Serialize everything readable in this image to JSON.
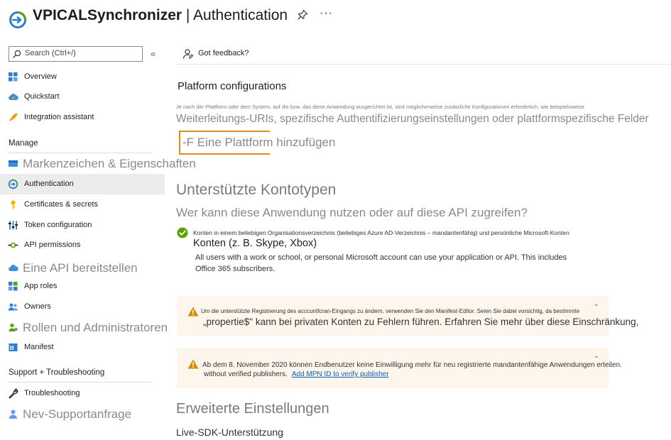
{
  "header": {
    "app_name": "VPICALSynchronizer",
    "separator": " | ",
    "page_name": "Authentication",
    "more_label": "···"
  },
  "sidebar": {
    "search_placeholder": "Search (Ctrl+/)",
    "collapse_label": "«",
    "items_top": [
      {
        "label": "Overview",
        "icon": "grid-icon"
      },
      {
        "label": "Quickstart",
        "icon": "cloud-icon"
      },
      {
        "label": "Integration assistant",
        "icon": "rocket-icon"
      }
    ],
    "section_manage": "Manage",
    "items_manage": [
      {
        "label": "Markenzeichen & Eigenschaften",
        "icon": "branding-icon"
      },
      {
        "label": "Authentication",
        "icon": "authentication-icon",
        "active": true
      },
      {
        "label": "Certificates & secrets",
        "icon": "key-icon"
      },
      {
        "label": "Token configuration",
        "icon": "token-icon"
      },
      {
        "label": "API permissions",
        "icon": "api-permissions-icon"
      },
      {
        "label": "Eine API bereitstellen",
        "icon": "cloud-api-icon"
      },
      {
        "label": "App roles",
        "icon": "app-roles-icon"
      },
      {
        "label": "Owners",
        "icon": "owners-icon"
      },
      {
        "label": "Rollen und Administratoren",
        "icon": "roles-icon"
      },
      {
        "label": "Manifest",
        "icon": "manifest-icon"
      }
    ],
    "section_support": "Support + Troubleshooting",
    "items_support": [
      {
        "label": "Troubleshooting",
        "icon": "wrench-icon"
      },
      {
        "label": "Nev-Supportanfrage",
        "icon": "support-person-icon"
      }
    ]
  },
  "cmdbar": {
    "feedback_label": "Got feedback?"
  },
  "platform": {
    "heading": "Platform configurations",
    "desc_small": "Je nach der Plattform oder dem System, auf die bzw. das diese Anwendung ausgerichtet ist, sind möglicherweise zusätzliche Konfigurationen erforderlich, wie beispielsweise",
    "desc_large": "Weiterleitungs-URIs, spezifische Authentifizierungseinstellungen oder plattformspezifische Felder",
    "add_button": "-F Eine Plattform hinzufügen"
  },
  "accounts": {
    "heading": "Unterstützte Kontotypen",
    "question": "Wer kann diese Anwendung nutzen oder auf diese API zugreifen?",
    "option_line1": "Konten in einem beliebigen Organisationsverzeichnis (beliebiges Azure AD-Verzeichnis – mandantenfähig) und persönliche Microsoft-Konten",
    "option_line2": "Konten (z. B. Skype, Xbox)",
    "help_line1": "All users with a work or school, or personal Microsoft account can use your application or API. This includes",
    "help_line2": "Office 365 subscribers."
  },
  "warnings": [
    {
      "line1": "Um die unterstützte Registrierung des acccuntfcran-Eingangs zu ändern, verwenden Sie den Manifest-Editor. Seien Sie dabei vorsichtig, da bestimmte",
      "line2": "„propertie$\" kann bei privaten Konten zu Fehlern führen. Erfahren Sie mehr über diese Einschränkung,"
    },
    {
      "line1": "Ab dem 8. November 2020 können Endbenutzer keine Einwilligung mehr für neu registrierte mandantenfähige Anwendungen erteilen.",
      "line2": "without verified publishers.",
      "link": "Add MPN ID to verify publisher"
    }
  ],
  "advanced": {
    "heading": "Erweiterte Einstellungen",
    "live_sdk": "Live-SDK-Unterstützung"
  },
  "colors": {
    "accent_orange": "#e08a1e",
    "link_blue": "#0b5fbf",
    "warning_bg": "#fdf6ec",
    "success_green": "#57a300",
    "active_nav_bg": "#ececec"
  }
}
